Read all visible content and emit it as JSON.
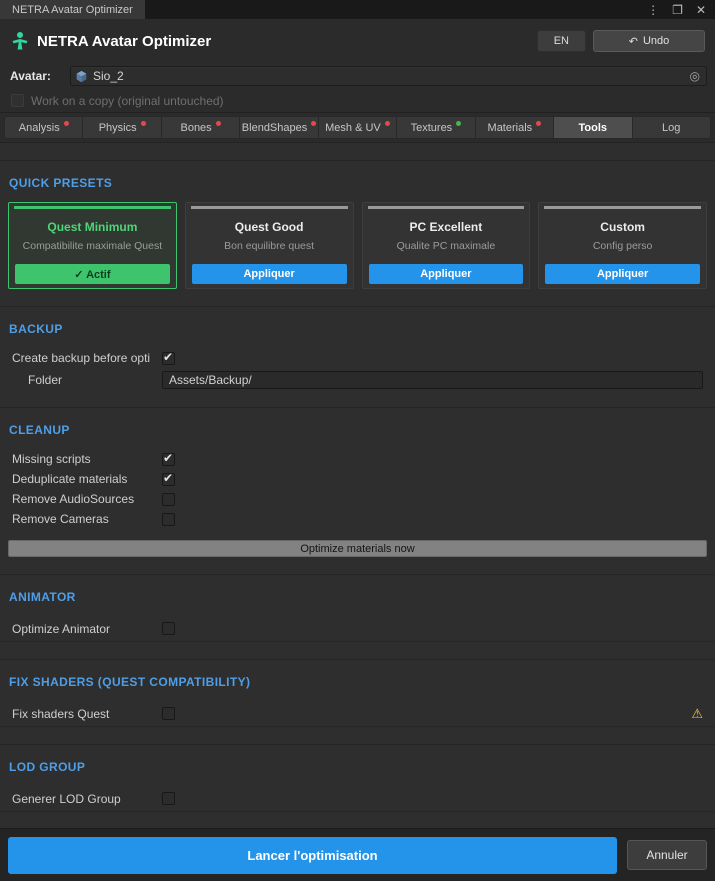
{
  "icons": {
    "menu": "⋮",
    "maximize": "❐",
    "close": "✕",
    "undo": "↶",
    "picker": "◎",
    "warning": "⚠"
  },
  "window": {
    "tab_title": "NETRA Avatar Optimizer"
  },
  "header": {
    "title": "NETRA Avatar Optimizer",
    "lang_button": "EN",
    "undo_button": "Undo"
  },
  "avatar": {
    "label": "Avatar:",
    "value": "Sio_2",
    "copy_label": "Work on a copy (original untouched)",
    "copy_checked": false
  },
  "tabs": [
    {
      "label": "Analysis",
      "dot": "red"
    },
    {
      "label": "Physics",
      "dot": "red"
    },
    {
      "label": "Bones",
      "dot": "red"
    },
    {
      "label": "BlendShapes",
      "dot": "red"
    },
    {
      "label": "Mesh & UV",
      "dot": "red"
    },
    {
      "label": "Textures",
      "dot": "green"
    },
    {
      "label": "Materials",
      "dot": "red"
    },
    {
      "label": "Tools",
      "dot": null,
      "active": true
    },
    {
      "label": "Log",
      "dot": null
    }
  ],
  "quick_presets": {
    "title": "QUICK PRESETS",
    "cards": [
      {
        "name": "Quest Minimum",
        "desc": "Compatibilite maximale Quest",
        "button": "✓ Actif",
        "active": true
      },
      {
        "name": "Quest Good",
        "desc": "Bon equilibre quest",
        "button": "Appliquer",
        "active": false
      },
      {
        "name": "PC Excellent",
        "desc": "Qualite PC maximale",
        "button": "Appliquer",
        "active": false
      },
      {
        "name": "Custom",
        "desc": "Config perso",
        "button": "Appliquer",
        "active": false
      }
    ]
  },
  "backup": {
    "title": "BACKUP",
    "create_label": "Create backup before opti",
    "create_checked": true,
    "folder_label": "Folder",
    "folder_value": "Assets/Backup/"
  },
  "cleanup": {
    "title": "CLEANUP",
    "items": [
      {
        "label": "Missing scripts",
        "checked": true
      },
      {
        "label": "Deduplicate materials",
        "checked": true
      },
      {
        "label": "Remove AudioSources",
        "checked": false
      },
      {
        "label": "Remove Cameras",
        "checked": false
      }
    ],
    "button": "Optimize materials now"
  },
  "animator": {
    "title": "ANIMATOR",
    "label": "Optimize Animator",
    "checked": false
  },
  "fix_shaders": {
    "title": "FIX SHADERS (QUEST COMPATIBILITY)",
    "label": "Fix shaders Quest",
    "checked": false
  },
  "lod": {
    "title": "LOD GROUP",
    "label": "Generer LOD Group",
    "checked": false
  },
  "footer": {
    "primary": "Lancer l'optimisation",
    "cancel": "Annuler"
  },
  "colors": {
    "accent_blue": "#2493ea",
    "section_header_blue": "#4f9ee8",
    "active_green": "#3ec46d",
    "tab_dot_red": "#e5484d",
    "tab_dot_green": "#43b84e",
    "warning_yellow": "#f5c542"
  }
}
